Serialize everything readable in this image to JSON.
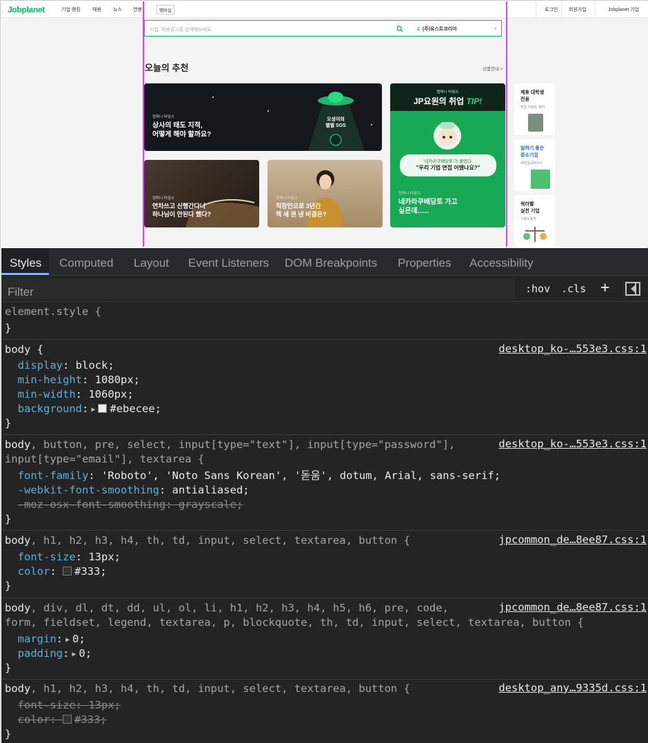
{
  "webpage": {
    "logo": "Jobplanet",
    "nav_items": [
      "기업 랭킹",
      "채용",
      "뉴스",
      "연봉"
    ],
    "member_label": "멤버십",
    "nav_right": [
      "로그인",
      "회원가입",
      "Jobplanet 기업"
    ],
    "search_placeholder": "기업, 채용공고를 검색해보세요.",
    "company_num": "2",
    "company_name": "(주)유스트코리아",
    "section_title": "오늘의 추천",
    "product_guide": "상품안내 >",
    "cards": [
      {
        "tag": "컴퍼니 타임스",
        "title": "상사의 태도 지적,\n어떻게 해야 할까요?",
        "badge": "오성이의\n별별 SOS"
      },
      {
        "tag": "컴퍼니 타임스",
        "header": "컴퍼니 타임스",
        "big": "JP요원의 취업",
        "tip": "TIP!",
        "bubble_top": "'네카라쿠배당토'가 물었다.",
        "bubble_main": "\"우리 기업 면접 어땠나요?\"",
        "title": "네카라쿠배당토 가고\n싶은데......"
      },
      {
        "tag": "컴퍼니 타임스",
        "title": "연차쓰고 신행간다니\n하나님이 안된다 했다?"
      },
      {
        "tag": "컴퍼니 타임스",
        "title": "직장인으로 3년간\n책 세 권 낸 비결은?"
      }
    ],
    "side_cards": [
      {
        "title": "제휴 대학생\n전용",
        "sub": "취업 리포트 센터"
      },
      {
        "title": "일하기 좋은\n중소기업",
        "sub": "대한상공회의소"
      },
      {
        "title": "워라벨\n실천 기업",
        "sub": "고용노동부"
      }
    ]
  },
  "devtools": {
    "tabs": [
      "Styles",
      "Computed",
      "Layout",
      "Event Listeners",
      "DOM Breakpoints",
      "Properties",
      "Accessibility"
    ],
    "active_tab": "Styles",
    "filter_placeholder": "Filter",
    "hov": ":hov",
    "cls": ".cls",
    "rules": [
      {
        "selector": "element.style {",
        "close": "}"
      },
      {
        "selector": "body {",
        "source": "desktop_ko-…553e3.css:1",
        "props": [
          {
            "name": "display",
            "value": "block;"
          },
          {
            "name": "min-height",
            "value": "1080px;"
          },
          {
            "name": "min-width",
            "value": "1060px;"
          },
          {
            "name": "background",
            "value": "#ebecee;",
            "swatch": "#ebecee",
            "expand": true
          }
        ]
      },
      {
        "selector_main": "body",
        "selector_rest": ", button, pre, select, input[type=\"text\"], input[type=\"password\"],",
        "selector_line2": "input[type=\"email\"], textarea {",
        "source": "desktop_ko-…553e3.css:1",
        "props": [
          {
            "name": "font-family",
            "value": "'Roboto', 'Noto Sans Korean', '돋움', dotum, Arial, sans-serif;"
          },
          {
            "name": "-webkit-font-smoothing",
            "value": "antialiased;"
          },
          {
            "name": "-moz-osx-font-smoothing",
            "value": "grayscale;",
            "struck": true
          }
        ]
      },
      {
        "selector_main": "body",
        "selector_rest": ", h1, h2, h3, h4, th, td, input, select, textarea, button {",
        "source": "jpcommon_de…8ee87.css:1",
        "props": [
          {
            "name": "font-size",
            "value": "13px;"
          },
          {
            "name": "color",
            "value": "#333;",
            "swatch": "#333333"
          }
        ]
      },
      {
        "selector_main": "body",
        "selector_rest": ", div, dl, dt, dd, ul, ol, li, h1, h2, h3, h4, h5, h6, pre, code,",
        "selector_line2": "form, fieldset, legend, textarea, p, blockquote, th, td, input, select, textarea, button {",
        "source": "jpcommon_de…8ee87.css:1",
        "props": [
          {
            "name": "margin",
            "value": "0;",
            "expand": true
          },
          {
            "name": "padding",
            "value": "0;",
            "expand": true
          }
        ]
      },
      {
        "selector_main": "body",
        "selector_rest": ", h1, h2, h3, h4, th, td, input, select, textarea, button {",
        "source": "desktop_any…9335d.css:1",
        "props": [
          {
            "name": "font-size",
            "value": "13px;",
            "struck": true
          },
          {
            "name": "color",
            "value": "#333;",
            "swatch": "#333333",
            "struck": true
          }
        ]
      }
    ]
  }
}
